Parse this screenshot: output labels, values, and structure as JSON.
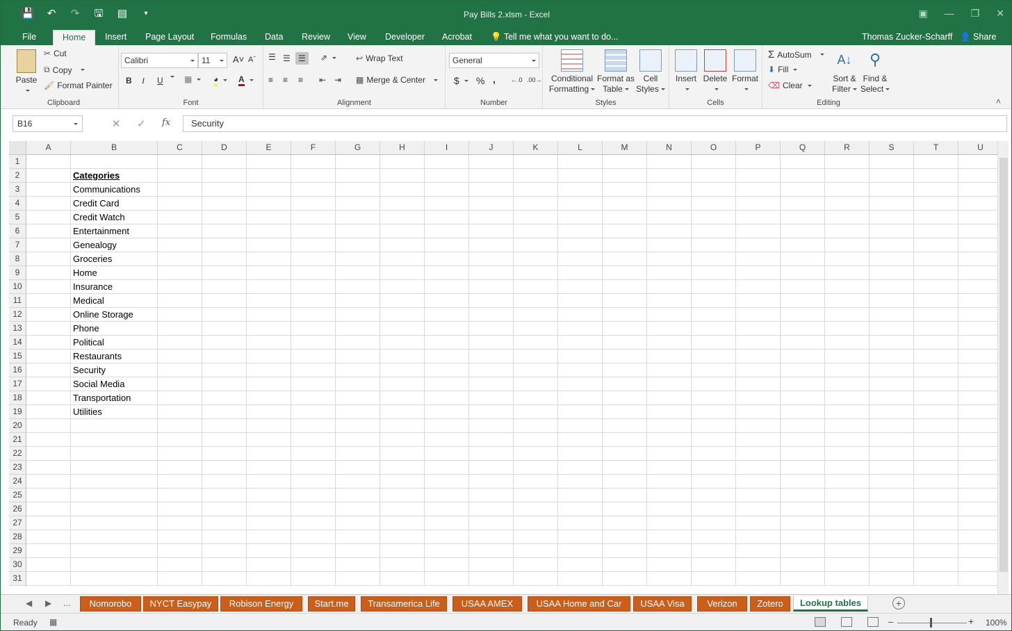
{
  "window": {
    "title": "Pay Bills 2.xlsm - Excel"
  },
  "qat": {
    "save_icon": "save-icon",
    "undo_icon": "undo-icon",
    "redo_icon": "redo-icon"
  },
  "tabs": [
    "File",
    "Home",
    "Insert",
    "Page Layout",
    "Formulas",
    "Data",
    "Review",
    "View",
    "Developer",
    "Acrobat"
  ],
  "tell_me": "Tell me what you want to do...",
  "user": "Thomas Zucker-Scharff",
  "share": "Share",
  "ribbon": {
    "clipboard": {
      "label": "Clipboard",
      "paste": "Paste",
      "cut": "Cut",
      "copy": "Copy",
      "format_painter": "Format Painter"
    },
    "font": {
      "label": "Font",
      "name": "Calibri",
      "size": "11",
      "bold": "B",
      "italic": "I",
      "underline": "U",
      "font_color": "#d00000"
    },
    "alignment": {
      "label": "Alignment",
      "wrap_text": "Wrap Text",
      "merge_center": "Merge & Center"
    },
    "number": {
      "label": "Number",
      "format": "General",
      "currency": "$",
      "percent": "%",
      "comma": ","
    },
    "styles": {
      "label": "Styles",
      "conditional1": "Conditional",
      "conditional2": "Formatting",
      "format_table1": "Format as",
      "format_table2": "Table",
      "cell_styles1": "Cell",
      "cell_styles2": "Styles"
    },
    "cells": {
      "label": "Cells",
      "insert": "Insert",
      "delete": "Delete",
      "format": "Format"
    },
    "editing": {
      "label": "Editing",
      "autosum": "AutoSum",
      "fill": "Fill",
      "clear": "Clear",
      "sort1": "Sort &",
      "sort2": "Filter",
      "find1": "Find &",
      "find2": "Select"
    }
  },
  "formula_bar": {
    "name_box": "B16",
    "fx": "fx",
    "content": "Security"
  },
  "columns": [
    "A",
    "B",
    "C",
    "D",
    "E",
    "F",
    "G",
    "H",
    "I",
    "J",
    "K",
    "L",
    "M",
    "N",
    "O",
    "P",
    "Q",
    "R",
    "S",
    "T",
    "U"
  ],
  "rows": [
    "1",
    "2",
    "3",
    "4",
    "5",
    "6",
    "7",
    "8",
    "9",
    "10",
    "11",
    "12",
    "13",
    "14",
    "15",
    "16",
    "17",
    "18",
    "19",
    "20",
    "21",
    "22",
    "23",
    "24",
    "25",
    "26",
    "27",
    "28",
    "29",
    "30",
    "31"
  ],
  "cells": {
    "B2": "Categories",
    "B3": "Communications",
    "B4": "Credit Card",
    "B5": "Credit Watch",
    "B6": "Entertainment",
    "B7": "Genealogy",
    "B8": "Groceries",
    "B9": "Home",
    "B10": "Insurance",
    "B11": "Medical",
    "B12": "Online Storage",
    "B13": "Phone",
    "B14": "Political",
    "B15": "Restaurants",
    "B16": "Security",
    "B17": "Social Media",
    "B18": "Transportation",
    "B19": "Utilities"
  },
  "sheet_tabs": [
    "Nomorobo",
    "NYCT Easypay",
    "Robison Energy",
    "Start.me",
    "Transamerica Life",
    "USAA AMEX",
    "USAA Home and Car",
    "USAA Visa",
    "Verizon",
    "Zotero",
    "Lookup tables"
  ],
  "active_sheet": "Lookup tables",
  "tab_overflow": "...",
  "status": {
    "text": "Ready",
    "zoom": "100%"
  }
}
